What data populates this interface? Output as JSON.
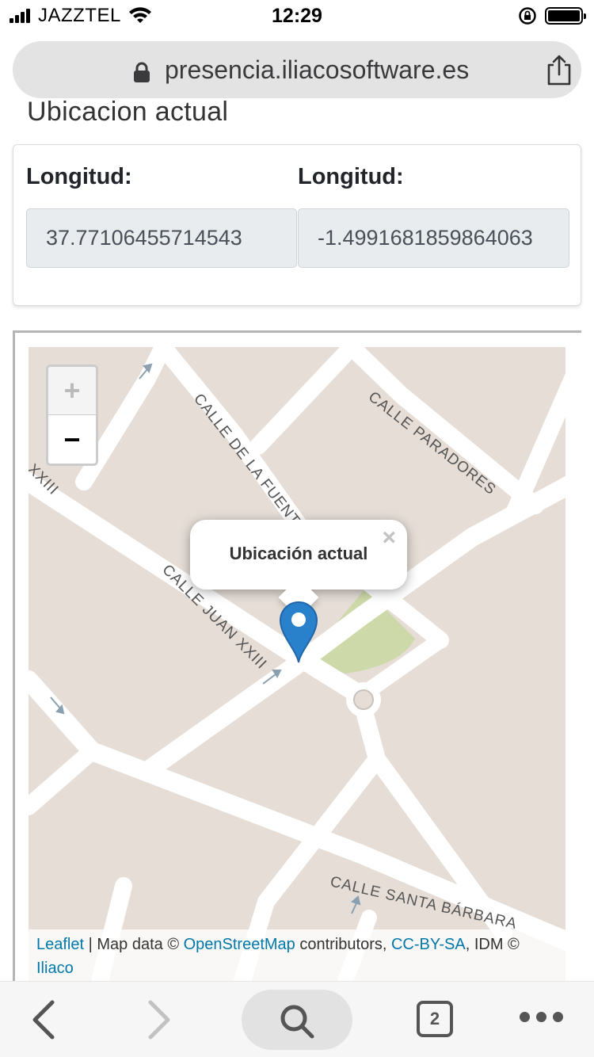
{
  "status_bar": {
    "carrier": "JAZZTEL",
    "time": "12:29"
  },
  "browser": {
    "url": "presencia.iliacosoftware.es",
    "tab_count": "2"
  },
  "page": {
    "heading": "Ubicacion actual"
  },
  "coordinates": {
    "left_label": "Longitud:",
    "left_value": "37.77106455714543",
    "right_label": "Longitud:",
    "right_value": "-1.4991681859864063"
  },
  "map": {
    "zoom_in": "+",
    "zoom_out": "−",
    "popup_text": "Ubicación actual",
    "popup_close": "×",
    "streets": {
      "fuente": "CALLE DE LA FUENTE",
      "paradores": "CALLE PARADORES",
      "juan": "CALLE JUAN XXIII",
      "juan_partial": "XXIII",
      "barbara": "CALLE SANTA BÁRBARA"
    },
    "attribution": {
      "leaflet": "Leaflet",
      "sep": " | Map data © ",
      "osm": "OpenStreetMap",
      "contributors": " contributors, ",
      "license": "CC-BY-SA",
      "idm": ", IDM © ",
      "iliaco": "Iliaco"
    },
    "colors": {
      "land": "#e5ddd6",
      "road": "#ffffff",
      "park": "#cdd9a8",
      "marker": "#2a81cb",
      "link": "#0078a8"
    }
  },
  "toolbar": {
    "icons": [
      "back-icon",
      "forward-icon",
      "search-icon",
      "tabs-icon",
      "more-icon"
    ]
  }
}
